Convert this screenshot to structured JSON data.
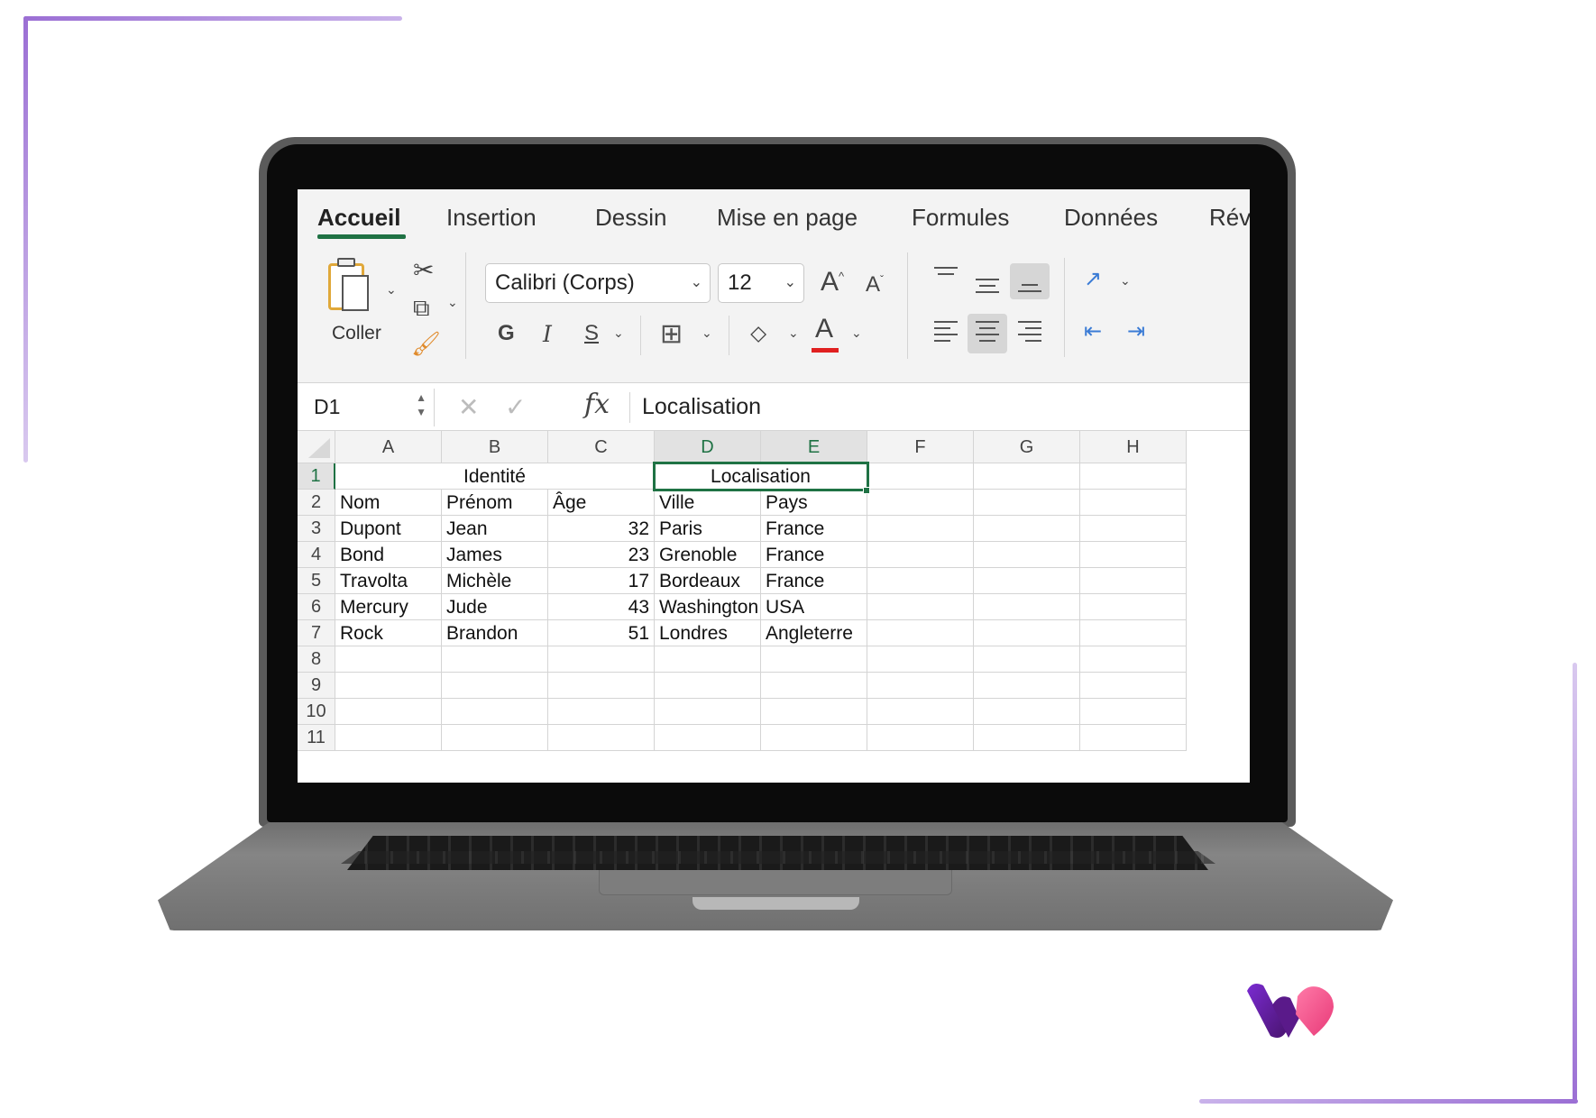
{
  "ribbon": {
    "tabs": [
      "Accueil",
      "Insertion",
      "Dessin",
      "Mise en page",
      "Formules",
      "Données",
      "Rév"
    ],
    "active_tab": "Accueil",
    "paste_label": "Coller",
    "font_name": "Calibri (Corps)",
    "font_size": "12",
    "bold": "G",
    "italic": "I",
    "underline": "S",
    "font_color_glyph": "A",
    "grow_font": "A",
    "shrink_font": "A",
    "accent_color": "#1f7244",
    "font_color_bar": "#e02020"
  },
  "formula_bar": {
    "name_box": "D1",
    "fx": "fx",
    "content": "Localisation"
  },
  "sheet": {
    "columns": [
      "A",
      "B",
      "C",
      "D",
      "E",
      "F",
      "G",
      "H"
    ],
    "rows": [
      "1",
      "2",
      "3",
      "4",
      "5",
      "6",
      "7",
      "8",
      "9",
      "10",
      "11"
    ],
    "selected_cell": "D1",
    "merged_headers": [
      "Identité",
      "Localisation"
    ],
    "header_row": [
      "Nom",
      "Prénom",
      "Âge",
      "Ville",
      "Pays"
    ],
    "data": [
      [
        "Dupont",
        "Jean",
        "32",
        "Paris",
        "France"
      ],
      [
        "Bond",
        "James",
        "23",
        "Grenoble",
        "France"
      ],
      [
        "Travolta",
        "Michèle",
        "17",
        "Bordeaux",
        "France"
      ],
      [
        "Mercury",
        "Jude",
        "43",
        "Washington",
        "USA"
      ],
      [
        "Rock",
        "Brandon",
        "51",
        "Londres",
        "Angleterre"
      ]
    ]
  }
}
